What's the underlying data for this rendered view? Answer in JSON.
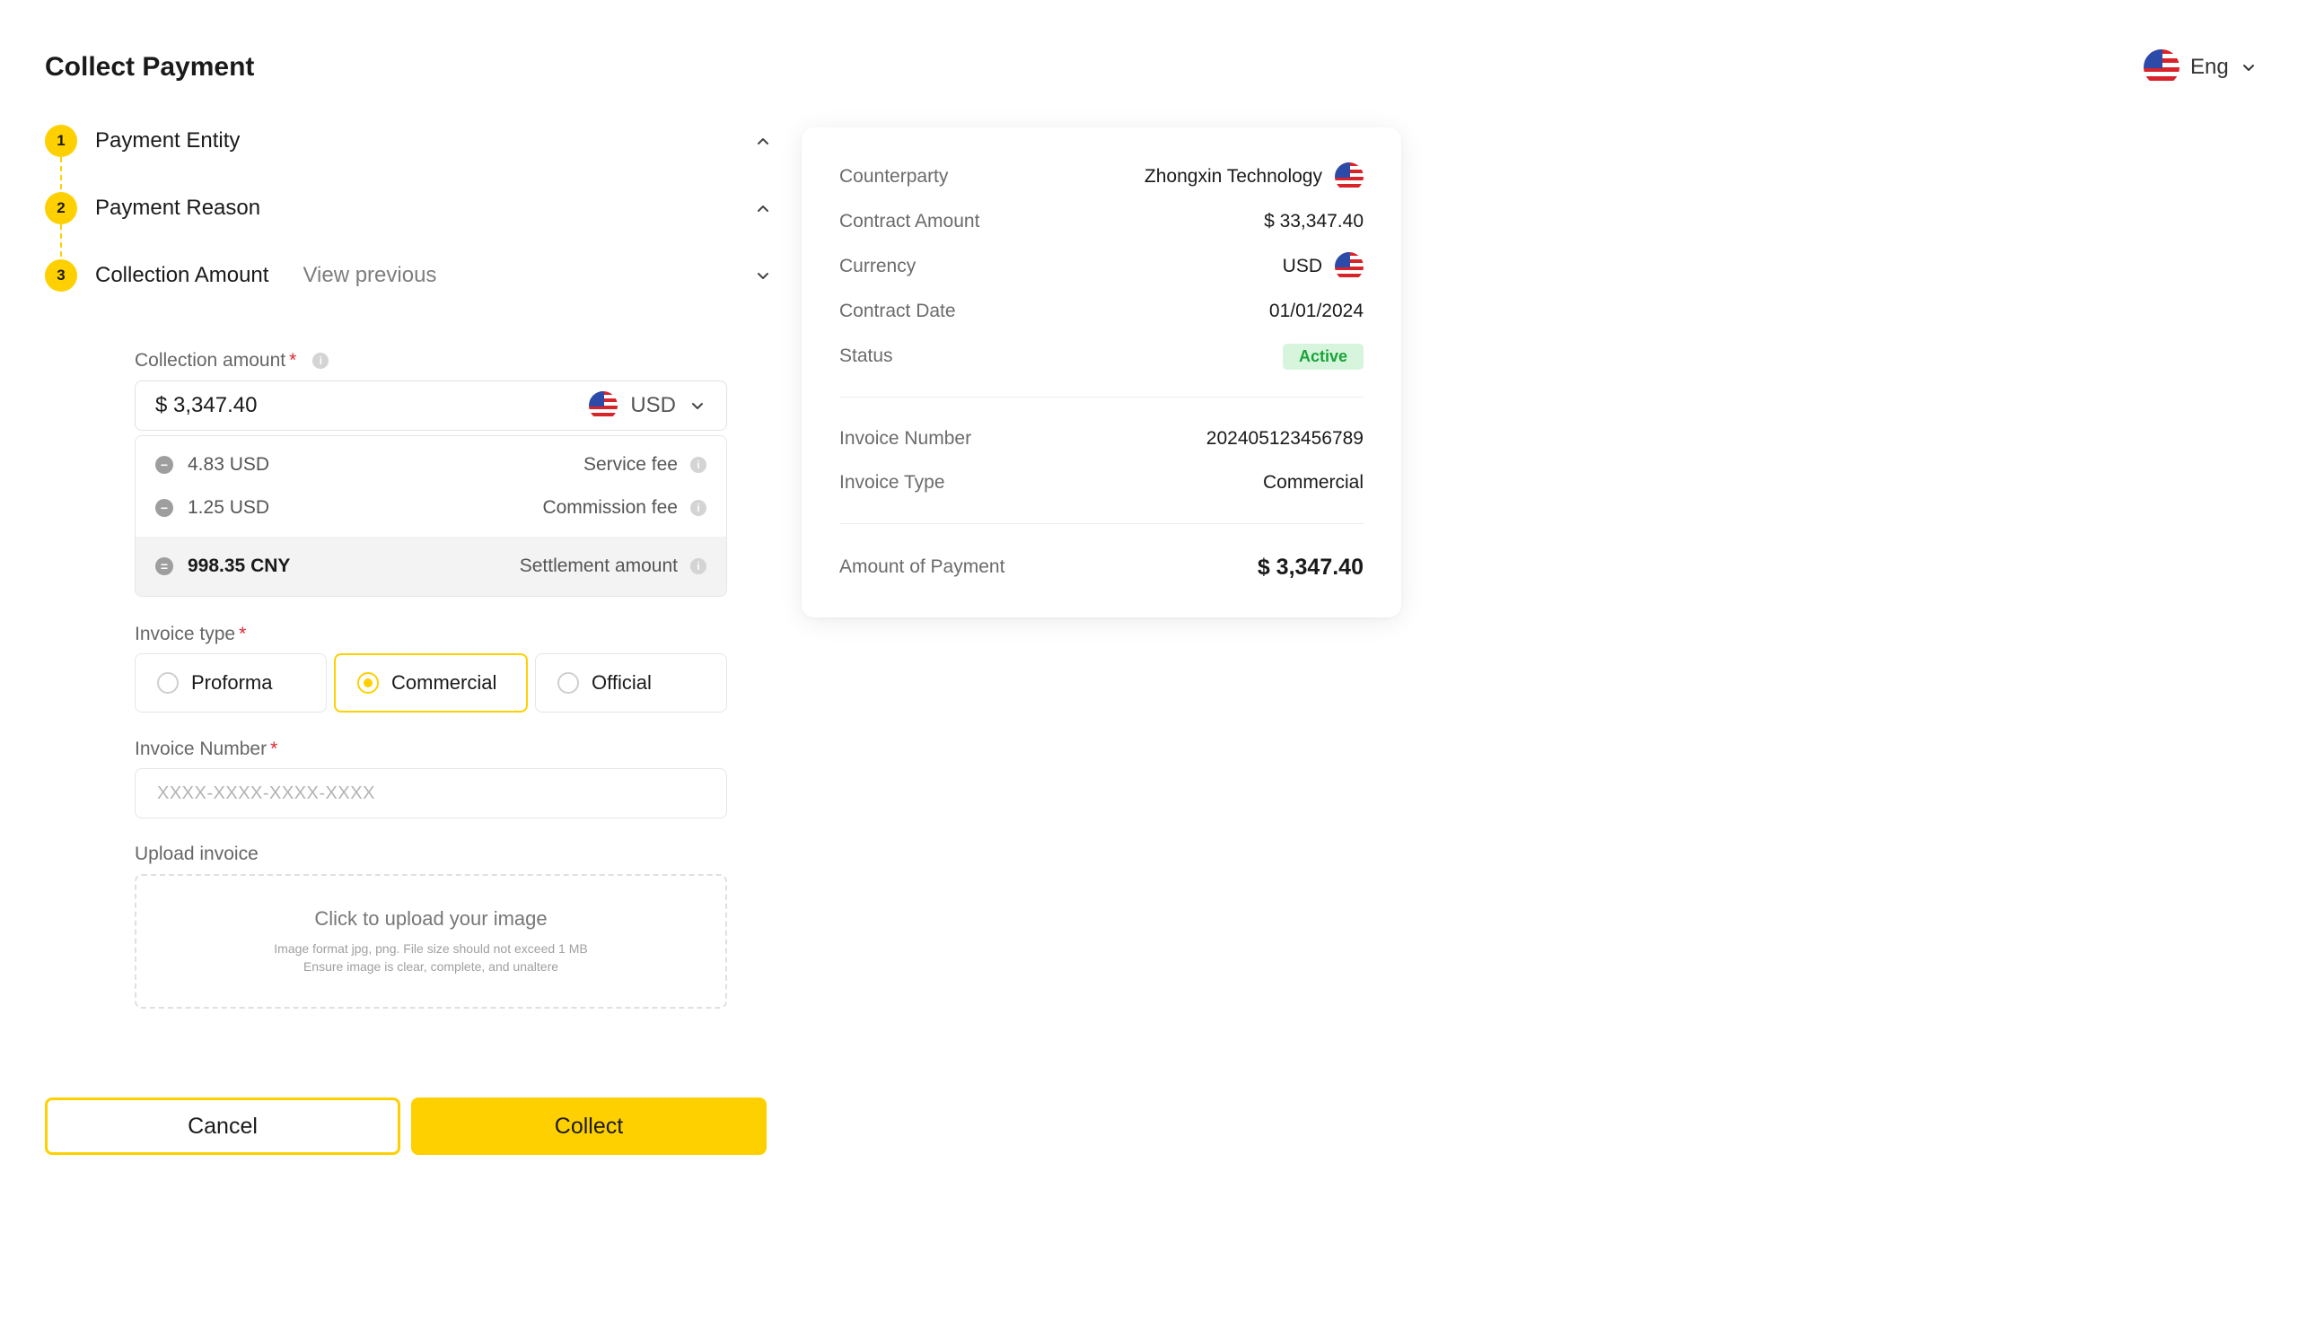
{
  "page": {
    "title": "Collect Payment"
  },
  "language": {
    "label": "Eng",
    "flag_icon": "us-flag-icon"
  },
  "steps": [
    {
      "number": "1",
      "label": "Payment Entity",
      "toggle_icon": "chevron-up-icon"
    },
    {
      "number": "2",
      "label": "Payment Reason",
      "toggle_icon": "chevron-up-icon"
    },
    {
      "number": "3",
      "label": "Collection Amount",
      "link": "View previous",
      "toggle_icon": "chevron-down-icon"
    }
  ],
  "form": {
    "collection_amount": {
      "label": "Collection amount",
      "required_mark": "*",
      "value": "$ 3,347.40",
      "currency": "USD"
    },
    "fees": [
      {
        "op": "−",
        "amount": "4.83 USD",
        "name": "Service fee"
      },
      {
        "op": "−",
        "amount": "1.25 USD",
        "name": "Commission fee"
      }
    ],
    "settlement": {
      "op": "=",
      "amount": "998.35 CNY",
      "name": "Settlement amount"
    },
    "invoice_type": {
      "label": "Invoice type",
      "required_mark": "*",
      "options": [
        "Proforma",
        "Commercial",
        "Official"
      ],
      "selected": "Commercial"
    },
    "invoice_number": {
      "label": "Invoice Number",
      "required_mark": "*",
      "value": "",
      "placeholder": "XXXX-XXXX-XXXX-XXXX"
    },
    "upload": {
      "label": "Upload invoice",
      "title": "Click to upload your image",
      "hint_1": "Image format jpg, png. File size should not exceed 1 MB",
      "hint_2": "Ensure image is clear, complete, and unaltere"
    }
  },
  "actions": {
    "cancel": "Cancel",
    "collect": "Collect"
  },
  "summary": {
    "counterparty": {
      "label": "Counterparty",
      "value": "Zhongxin Technology"
    },
    "contract_amount": {
      "label": "Contract Amount",
      "value": "$ 33,347.40"
    },
    "currency": {
      "label": "Currency",
      "value": "USD"
    },
    "contract_date": {
      "label": "Contract Date",
      "value": "01/01/2024"
    },
    "status": {
      "label": "Status",
      "value": "Active"
    },
    "invoice_number": {
      "label": "Invoice Number",
      "value": "202405123456789"
    },
    "invoice_type": {
      "label": "Invoice Type",
      "value": "Commercial"
    },
    "amount_of_payment": {
      "label": "Amount of Payment",
      "value": "$ 3,347.40"
    }
  },
  "colors": {
    "accent": "#ffd000",
    "required": "#e0282e",
    "status_active_bg": "#d6f5dc",
    "status_active_text": "#1aa33a"
  }
}
